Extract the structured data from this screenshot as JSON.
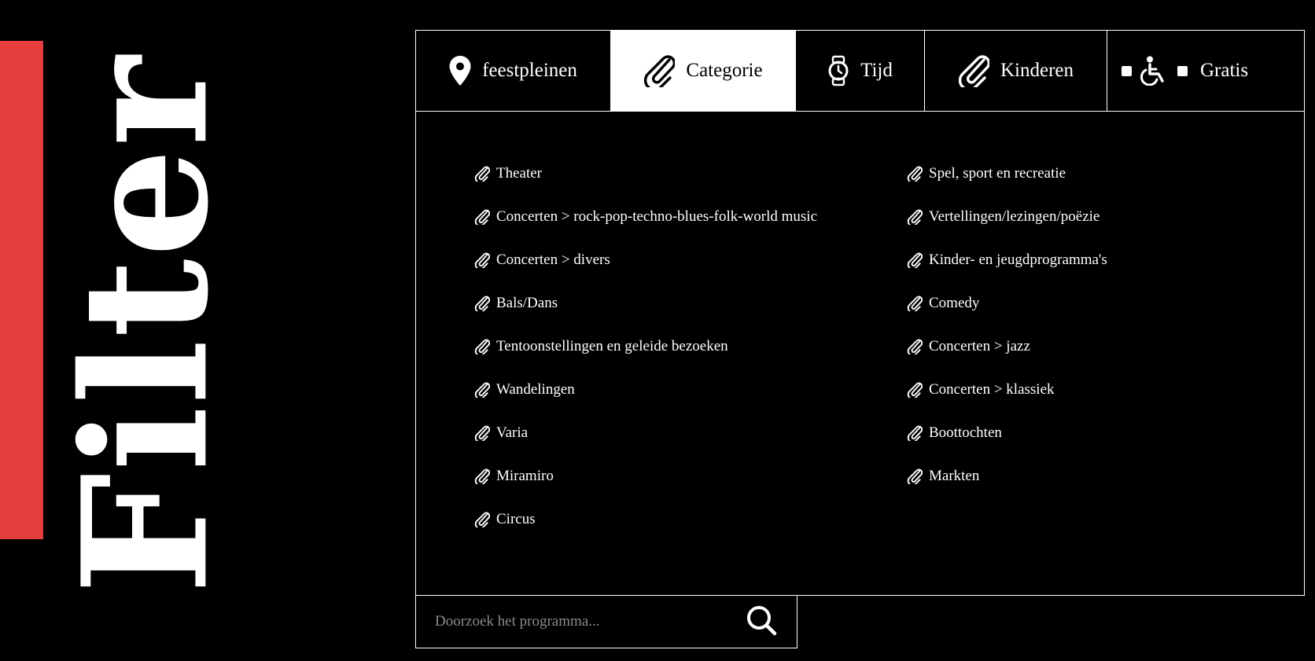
{
  "page_title": "Filter",
  "tabs": [
    {
      "label": "feestpleinen",
      "icon": "location-pin-icon",
      "active": false
    },
    {
      "label": "Categorie",
      "icon": "paperclip-icon",
      "active": true
    },
    {
      "label": "Tijd",
      "icon": "watch-icon",
      "active": false
    },
    {
      "label": "Kinderen",
      "icon": "paperclip-icon",
      "active": false
    }
  ],
  "extras": {
    "accessible_icon": "wheelchair-icon",
    "free_label": "Gratis"
  },
  "categories_left": [
    "Theater",
    "Concerten > rock-pop-techno-blues-folk-world music",
    "Concerten > divers",
    "Bals/Dans",
    "Tentoonstellingen en geleide bezoeken",
    "Wandelingen",
    "Varia",
    "Miramiro",
    "Circus"
  ],
  "categories_right": [
    "Spel, sport en recreatie",
    "Vertellingen/lezingen/poëzie",
    "Kinder- en jeugdprogramma's",
    "Comedy",
    "Concerten > jazz",
    "Concerten > klassiek",
    "Boottochten",
    "Markten"
  ],
  "search": {
    "placeholder": "Doorzoek het programma...",
    "value": "",
    "icon": "search-icon"
  },
  "colors": {
    "accent": "#e63d3f",
    "background": "#000000",
    "foreground": "#ffffff"
  }
}
